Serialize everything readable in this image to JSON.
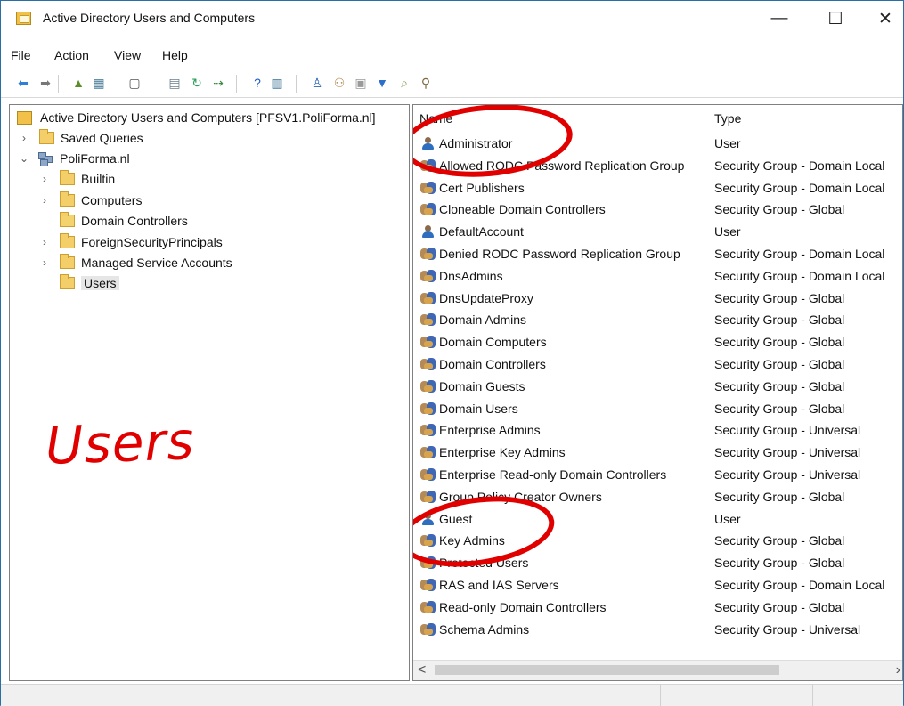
{
  "window": {
    "title": "Active Directory Users and Computers",
    "controls": {
      "minimize": "—",
      "maximize": "☐",
      "close": "✕"
    }
  },
  "menu": [
    "File",
    "Action",
    "View",
    "Help"
  ],
  "toolbar": {
    "buttons": [
      "back",
      "forward",
      "up",
      "show-hide-console-tree",
      "properties",
      "export-list",
      "refresh",
      "help",
      "view",
      "new-user",
      "new-group",
      "new-ou",
      "filter",
      "find",
      "delegate"
    ]
  },
  "tree": {
    "root": "Active Directory Users and Computers [PFSV1.PoliForma.nl]",
    "items": [
      {
        "label": "Saved Queries",
        "level": 1,
        "expanded": false
      },
      {
        "label": "PoliForma.nl",
        "level": 1,
        "expanded": true
      },
      {
        "label": "Builtin",
        "level": 2,
        "expanded": false
      },
      {
        "label": "Computers",
        "level": 2,
        "expanded": false
      },
      {
        "label": "Domain Controllers",
        "level": 2,
        "expanded": false
      },
      {
        "label": "ForeignSecurityPrincipals",
        "level": 2,
        "expanded": false
      },
      {
        "label": "Managed Service Accounts",
        "level": 2,
        "expanded": false
      },
      {
        "label": "Users",
        "level": 2,
        "selected": true
      }
    ]
  },
  "annotation": {
    "text": "Users",
    "color": "#e10000"
  },
  "list": {
    "columns": [
      "Name",
      "Type"
    ],
    "rows": [
      {
        "name": "Administrator",
        "type": "User",
        "icon": "user-icon"
      },
      {
        "name": "Allowed RODC Password Replication Group",
        "type": "Security Group - Domain Local",
        "icon": "group-icon"
      },
      {
        "name": "Cert Publishers",
        "type": "Security Group - Domain Local",
        "icon": "group-icon"
      },
      {
        "name": "Cloneable Domain Controllers",
        "type": "Security Group - Global",
        "icon": "group-icon"
      },
      {
        "name": "DefaultAccount",
        "type": "User",
        "icon": "user-icon"
      },
      {
        "name": "Denied RODC Password Replication Group",
        "type": "Security Group - Domain Local",
        "icon": "group-icon"
      },
      {
        "name": "DnsAdmins",
        "type": "Security Group - Domain Local",
        "icon": "group-icon"
      },
      {
        "name": "DnsUpdateProxy",
        "type": "Security Group - Global",
        "icon": "group-icon"
      },
      {
        "name": "Domain Admins",
        "type": "Security Group - Global",
        "icon": "group-icon"
      },
      {
        "name": "Domain Computers",
        "type": "Security Group - Global",
        "icon": "group-icon"
      },
      {
        "name": "Domain Controllers",
        "type": "Security Group - Global",
        "icon": "group-icon"
      },
      {
        "name": "Domain Guests",
        "type": "Security Group - Global",
        "icon": "group-icon"
      },
      {
        "name": "Domain Users",
        "type": "Security Group - Global",
        "icon": "group-icon"
      },
      {
        "name": "Enterprise Admins",
        "type": "Security Group - Universal",
        "icon": "group-icon"
      },
      {
        "name": "Enterprise Key Admins",
        "type": "Security Group - Universal",
        "icon": "group-icon"
      },
      {
        "name": "Enterprise Read-only Domain Controllers",
        "type": "Security Group - Universal",
        "icon": "group-icon"
      },
      {
        "name": "Group Policy Creator Owners",
        "type": "Security Group - Global",
        "icon": "group-icon"
      },
      {
        "name": "Guest",
        "type": "User",
        "icon": "user-icon"
      },
      {
        "name": "Key Admins",
        "type": "Security Group - Global",
        "icon": "group-icon"
      },
      {
        "name": "Protected Users",
        "type": "Security Group - Global",
        "icon": "group-icon"
      },
      {
        "name": "RAS and IAS Servers",
        "type": "Security Group - Domain Local",
        "icon": "group-icon"
      },
      {
        "name": "Read-only Domain Controllers",
        "type": "Security Group - Global",
        "icon": "group-icon"
      },
      {
        "name": "Schema Admins",
        "type": "Security Group - Universal",
        "icon": "group-icon"
      }
    ]
  },
  "scrollbar": {
    "left_arrow": "<",
    "right_arrow": "›"
  }
}
